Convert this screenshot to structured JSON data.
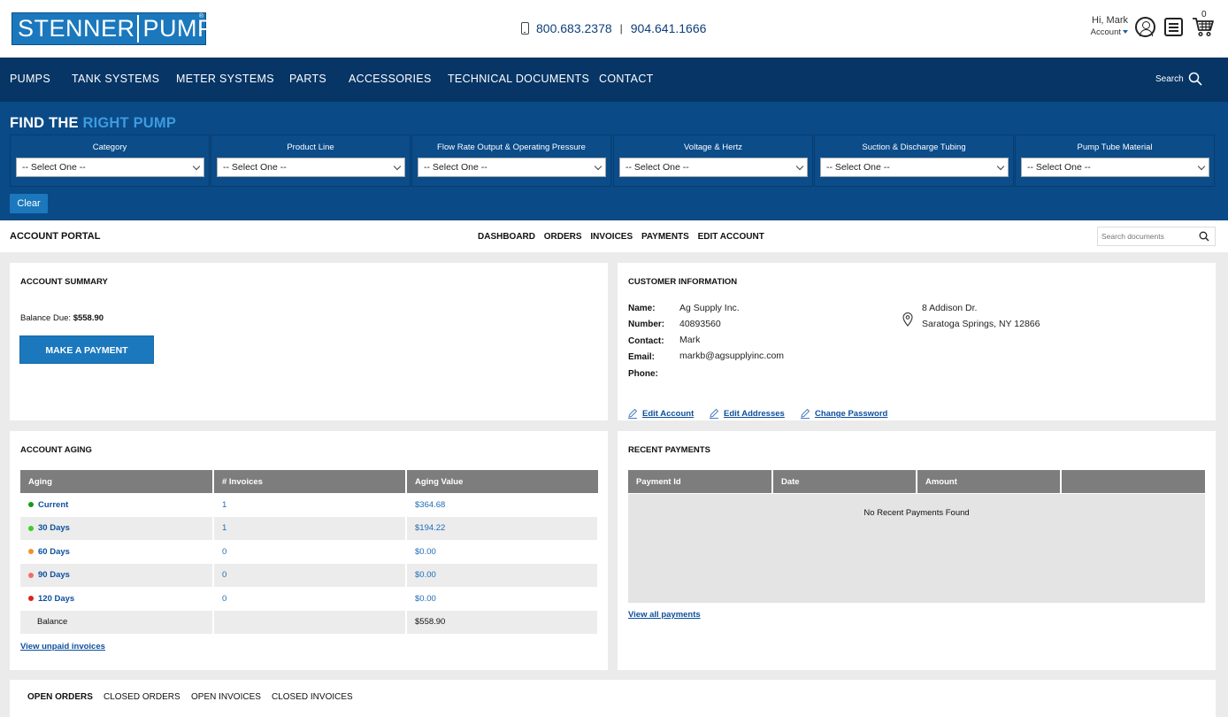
{
  "header": {
    "logo_word1": "STENNER",
    "logo_word2": "PUMPS",
    "logo_reg": "®",
    "phone1": "800.683.2378",
    "phone_sep": "|",
    "phone2": "904.641.1666",
    "greeting": "Hi, Mark",
    "account_label": "Account",
    "cart_count": "0"
  },
  "nav": {
    "items": [
      "PUMPS",
      "TANK SYSTEMS",
      "METER SYSTEMS",
      "PARTS",
      "ACCESSORIES",
      "TECHNICAL DOCUMENTS",
      "CONTACT"
    ],
    "search_label": "Search"
  },
  "finder": {
    "title_part1": "FIND THE ",
    "title_part2": "RIGHT PUMP",
    "filters": [
      {
        "label": "Category",
        "value": "-- Select One --"
      },
      {
        "label": "Product Line",
        "value": "-- Select One --"
      },
      {
        "label": "Flow Rate Output & Operating Pressure",
        "value": "-- Select One --"
      },
      {
        "label": "Voltage & Hertz",
        "value": "-- Select One --"
      },
      {
        "label": "Suction & Discharge Tubing",
        "value": "-- Select One --"
      },
      {
        "label": "Pump Tube Material",
        "value": "-- Select One --"
      }
    ],
    "clear_label": "Clear"
  },
  "portal": {
    "title": "ACCOUNT PORTAL",
    "tabs": [
      "DASHBOARD",
      "ORDERS",
      "INVOICES",
      "PAYMENTS",
      "EDIT ACCOUNT"
    ],
    "search_placeholder": "Search documents"
  },
  "summary": {
    "heading": "ACCOUNT SUMMARY",
    "balance_label": "Balance Due: ",
    "balance_value": "$558.90",
    "pay_button": "MAKE A PAYMENT"
  },
  "customer": {
    "heading": "CUSTOMER INFORMATION",
    "labels": {
      "name": "Name:",
      "number": "Number:",
      "contact": "Contact:",
      "email": "Email:",
      "phone": "Phone:"
    },
    "name": "Ag Supply Inc.",
    "number": "40893560",
    "contact": "Mark",
    "email": "markb@agsupplyinc.com",
    "phone": "",
    "address_line1": "8 Addison Dr.",
    "address_line2": "Saratoga Springs, NY 12866",
    "links": {
      "edit_account": "Edit Account",
      "edit_addresses": "Edit Addresses",
      "change_password": "Change Password"
    }
  },
  "aging": {
    "heading": "ACCOUNT AGING",
    "columns": [
      "Aging",
      "# Invoices",
      "Aging Value"
    ],
    "rows": [
      {
        "label": "Current",
        "invoices": "1",
        "value": "$364.68",
        "color": "#1a9a1a"
      },
      {
        "label": "30 Days",
        "invoices": "1",
        "value": "$194.22",
        "color": "#3ccc2a"
      },
      {
        "label": "60 Days",
        "invoices": "0",
        "value": "$0.00",
        "color": "#f0922a"
      },
      {
        "label": "90 Days",
        "invoices": "0",
        "value": "$0.00",
        "color": "#f26b6b"
      },
      {
        "label": "120 Days",
        "invoices": "0",
        "value": "$0.00",
        "color": "#e02020"
      }
    ],
    "balance_label": "Balance",
    "balance_value": "$558.90",
    "view_link": "View unpaid invoices"
  },
  "payments": {
    "heading": "RECENT PAYMENTS",
    "columns": [
      "Payment Id",
      "Date",
      "Amount",
      ""
    ],
    "empty_text": "No Recent Payments Found",
    "view_link": "View all payments"
  },
  "bottom_tabs": [
    "OPEN ORDERS",
    "CLOSED ORDERS",
    "OPEN INVOICES",
    "CLOSED INVOICES"
  ],
  "colors": {
    "brand_blue": "#1b78bd",
    "nav_navy": "#063566",
    "finder_blue": "#0a4a86",
    "link_blue": "#0d4f9e"
  }
}
